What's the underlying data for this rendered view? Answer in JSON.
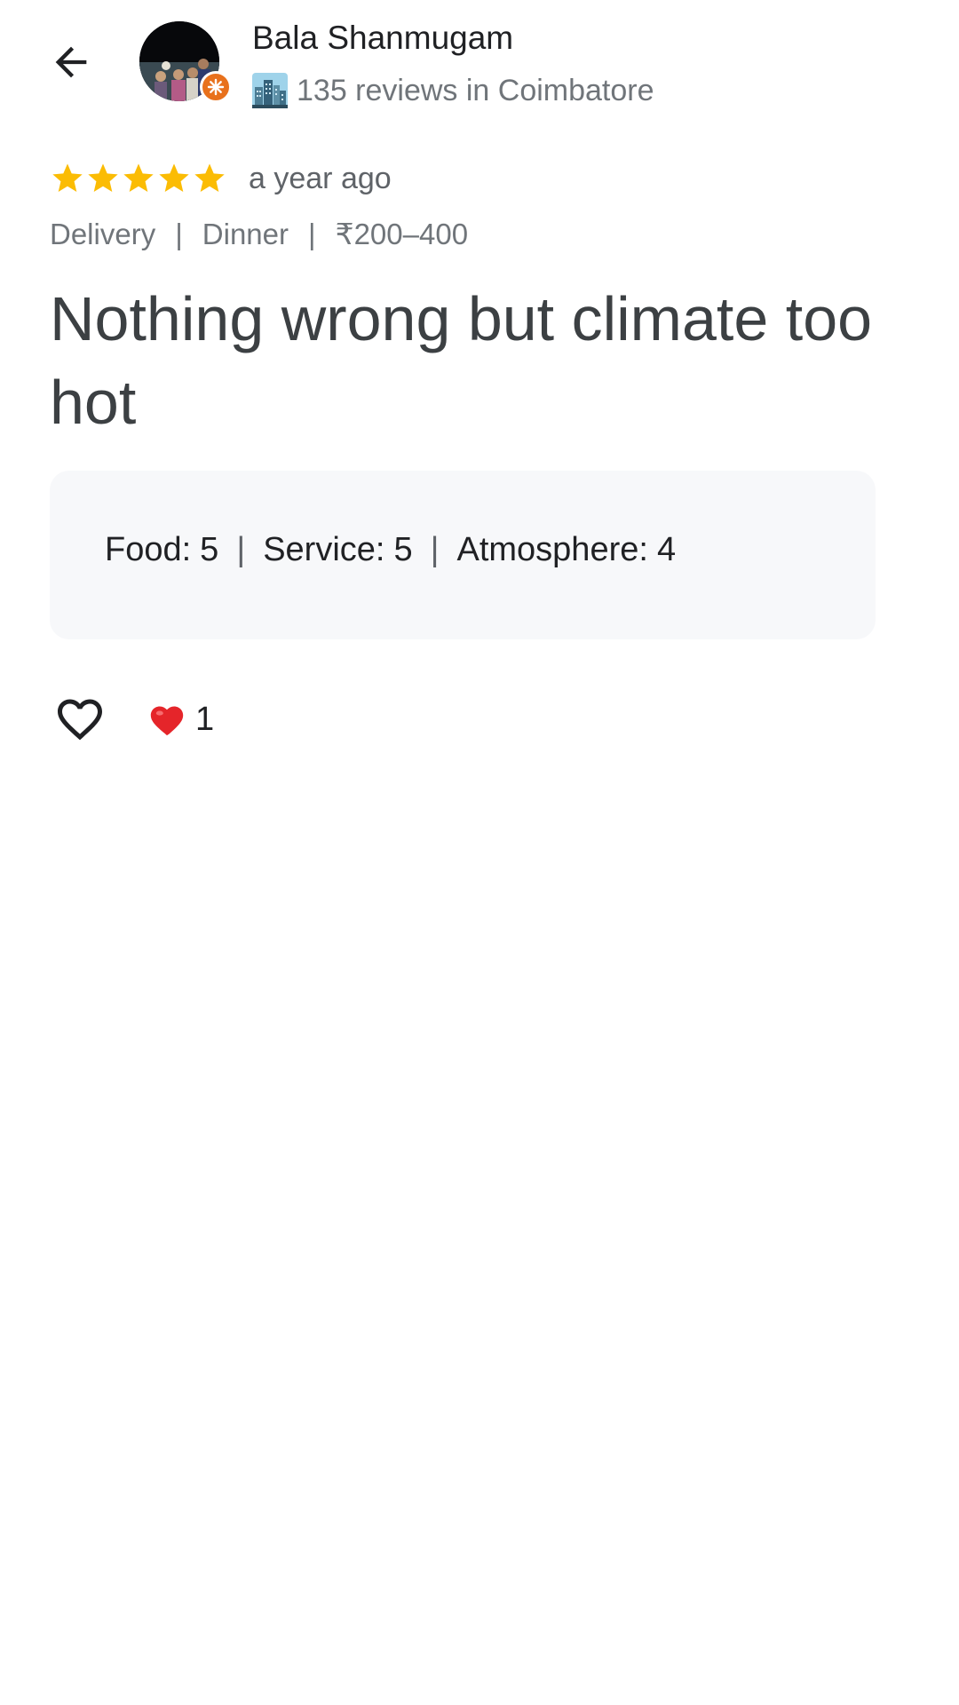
{
  "header": {
    "back_icon": "arrow-left-icon",
    "user_name": "Bala Shanmugam",
    "badge_icon": "local-guide-badge-icon",
    "badge_color": "#e8711c",
    "city_icon": "cityscape-icon",
    "reviews_summary": "135 reviews in Coimbatore"
  },
  "review": {
    "rating": 5,
    "rating_max": 5,
    "star_color": "#fbbc04",
    "time_ago": "a year ago",
    "tags": [
      "Delivery",
      "Dinner",
      "₹200–400"
    ],
    "text": "Nothing wrong but climate too hot",
    "subratings": [
      {
        "label": "Food:",
        "value": "5"
      },
      {
        "label": "Service:",
        "value": "5"
      },
      {
        "label": "Atmosphere:",
        "value": "4"
      }
    ]
  },
  "actions": {
    "like_icon": "heart-outline-icon",
    "reaction_icon": "red-heart-icon",
    "reaction_count": "1"
  }
}
